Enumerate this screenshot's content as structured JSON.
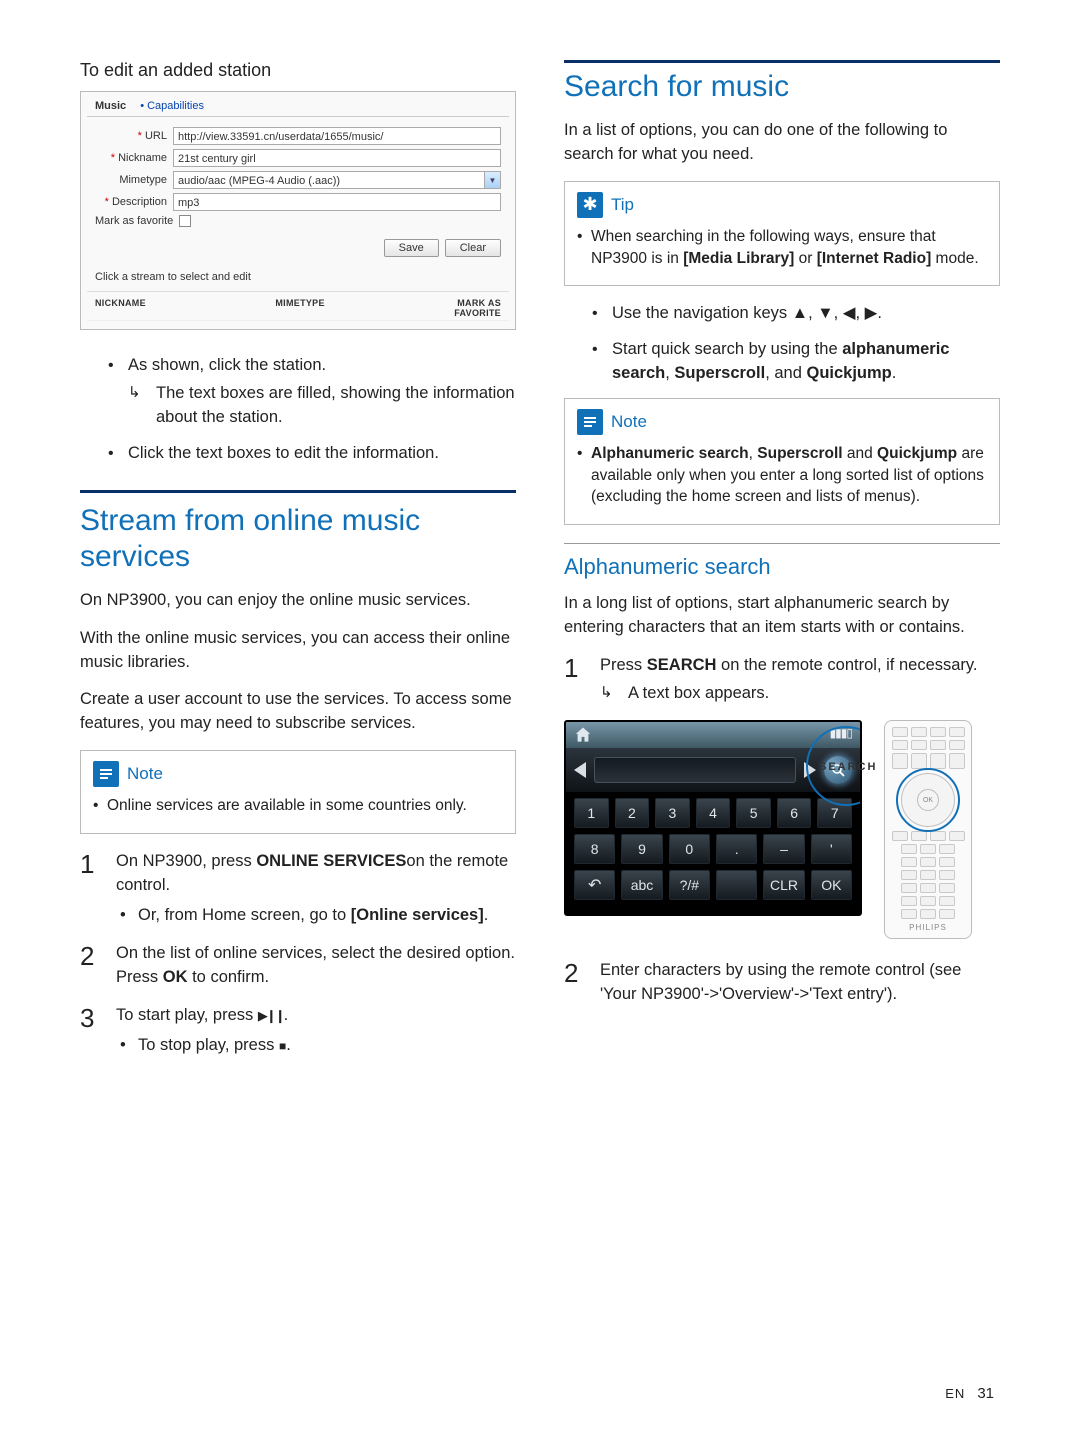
{
  "left": {
    "edit_title": "To edit an added station",
    "form": {
      "tab_music": "Music",
      "tab_capabilities": "Capabilities",
      "url_label": "URL",
      "url_value": "http://view.33591.cn/userdata/1655/music/",
      "nickname_label": "Nickname",
      "nickname_value": "21st century girl",
      "mimetype_label": "Mimetype",
      "mimetype_value": "audio/aac (MPEG-4 Audio (.aac))",
      "description_label": "Description",
      "description_value": "mp3",
      "mark_fav_label": "Mark as favorite",
      "save": "Save",
      "clear": "Clear",
      "hint": "Click a stream to select and edit",
      "col_nickname": "NICKNAME",
      "col_mimetype": "MIMETYPE",
      "col_markfav": "MARK AS\nFAVORITE"
    },
    "bullet_a": "As shown, click the station.",
    "bullet_a_sub": "The text boxes are filled, showing the information about the station.",
    "bullet_b": "Click the text boxes to edit the information.",
    "stream_h1": "Stream from online music services",
    "stream_p1": "On NP3900, you can enjoy the online music services.",
    "stream_p2": "With the online music services, you can access their online music libraries.",
    "stream_p3": "Create a user account to use the services. To access some features, you may need to subscribe services.",
    "note_label": "Note",
    "note_text": "Online services are available in some countries only.",
    "step1_a": "On NP3900, press ",
    "step1_b": "ONLINE SERVICES",
    "step1_c": "on the remote control.",
    "step1_sub_a": "Or, from Home screen, go to ",
    "step1_sub_b": "[Online services]",
    "step1_sub_c": ".",
    "step2_a": "On the list of online services, select the desired option. Press ",
    "step2_b": "OK",
    "step2_c": " to confirm.",
    "step3_a": "To start play, press ",
    "step3_icon": "▶❙❙",
    "step3_c": ".",
    "step3_sub_a": "To stop play, press ",
    "step3_sub_icon": "■",
    "step3_sub_c": "."
  },
  "right": {
    "h1": "Search for music",
    "intro": "In a list of options, you can do one of the following to search for what you need.",
    "tip_label": "Tip",
    "tip_a": "When searching in the following ways, ensure that NP3900 is in ",
    "tip_b": "[Media Library]",
    "tip_c": " or ",
    "tip_d": "[Internet Radio]",
    "tip_e": " mode.",
    "nav_a": "Use the navigation keys ",
    "nav_icons": "▲, ▼, ◀, ▶",
    "nav_c": ".",
    "quick_a": "Start quick search by using the ",
    "quick_b": "alphanumeric search",
    "quick_c": ", ",
    "quick_d": "Superscroll",
    "quick_e": ", and ",
    "quick_f": "Quickjump",
    "quick_g": ".",
    "note_label": "Note",
    "note_a": "Alphanumeric search",
    "note_b": ", ",
    "note_c": "Superscroll",
    "note_d": " and ",
    "note_e": "Quickjump",
    "note_f": " are available only when you enter a long sorted list of options (excluding the home screen and lists of menus).",
    "alpha_h2": "Alphanumeric search",
    "alpha_p": "In a long list of options, start alphanumeric search by entering characters that an item starts with or contains.",
    "step1_a": "Press ",
    "step1_b": "SEARCH",
    "step1_c": " on the remote control, if necessary.",
    "step1_sub": "A text box appears.",
    "search_label": "SEARCH",
    "remote_ok": "OK",
    "remote_brand": "PHILIPS",
    "keys_r1": [
      "1",
      "2",
      "3",
      "4",
      "5",
      "6",
      "7"
    ],
    "keys_r2": [
      "8",
      "9",
      "0",
      ".",
      "–",
      "'"
    ],
    "keys_r3_undo": "↶",
    "keys_r3": [
      "abc",
      "?/#",
      "",
      "CLR",
      "OK"
    ],
    "step2": "Enter characters by using the remote control (see 'Your NP3900'->'Overview'->'Text entry')."
  },
  "footer_lang": "EN",
  "footer_page": "31"
}
